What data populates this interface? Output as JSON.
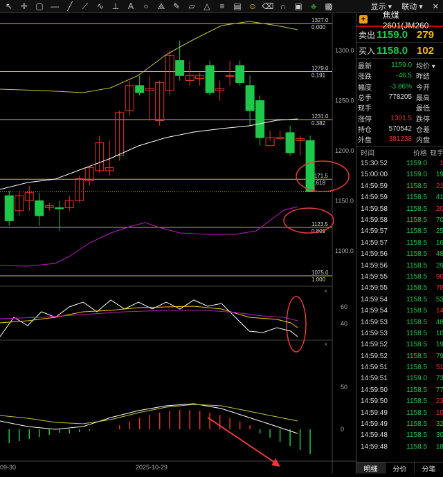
{
  "toolbar": {
    "icons": [
      "cursor-icon",
      "crosshair-icon",
      "rect-icon",
      "hline-icon",
      "channel-icon",
      "ray-icon",
      "wave-icon",
      "measure-icon",
      "text-icon",
      "circle-icon",
      "fan-icon",
      "pen-icon",
      "parallel-icon",
      "triangle-icon",
      "fib-icon",
      "ruler-icon",
      "emoji-icon",
      "erase-icon",
      "magnet-icon",
      "lock-icon",
      "tree-icon",
      "pic-icon"
    ],
    "right_menu": [
      "显示 ▾",
      "联动 ▾",
      "✕"
    ]
  },
  "chart_main": {
    "price_labels": [
      "1300.0",
      "1250.0",
      "1200.0",
      "1150.0",
      "1100.0"
    ],
    "fib_levels": [
      {
        "price": "1327.0",
        "ratio": "0.000"
      },
      {
        "price": "1279.0",
        "ratio": "0.191"
      },
      {
        "price": "1231.0",
        "ratio": "0.382"
      },
      {
        "price": "1171.5",
        "ratio": "0.618"
      },
      {
        "price": "1123.5",
        "ratio": "0.809"
      },
      {
        "price": "1075.0",
        "ratio": "1.000"
      }
    ],
    "close_marker_price": "1159.0"
  },
  "indicator1": {
    "labels": [
      "60",
      "40"
    ]
  },
  "indicator2": {
    "labels": [
      "50",
      "0"
    ]
  },
  "xaxis": {
    "labels": [
      "09-30",
      "2025-10-29"
    ]
  },
  "panel": {
    "title": "焦煤2601(JM260",
    "sell": {
      "label": "卖出",
      "price": "1159.0",
      "vol": "279"
    },
    "buy": {
      "label": "买入",
      "price": "1158.0",
      "vol": "102"
    },
    "stats": [
      {
        "k": "最新",
        "v": "1159.0",
        "cls": "green",
        "k2": "均价 ▾"
      },
      {
        "k": "涨跌",
        "v": "-46.5",
        "cls": "green",
        "k2": "昨结"
      },
      {
        "k": "幅度",
        "v": "-3.86%",
        "cls": "green",
        "k2": "今开"
      },
      {
        "k": "总手",
        "v": "778205",
        "cls": "white",
        "k2": "最高"
      },
      {
        "k": "现手",
        "v": "",
        "cls": "white",
        "k2": "最低"
      },
      {
        "k": "涨停",
        "v": "1301.5",
        "cls": "red",
        "k2": "跌停"
      },
      {
        "k": "持仓",
        "v": "570542",
        "cls": "white",
        "k2": "仓差"
      },
      {
        "k": "外盘",
        "v": "381238",
        "cls": "red",
        "k2": "内盘"
      }
    ],
    "tick_headers": [
      "时间",
      "价格",
      "现手"
    ],
    "ticks": [
      {
        "t": "15:30:52",
        "p": "1159.0",
        "v": "1",
        "c": "red"
      },
      {
        "t": "15:00:00",
        "p": "1159.0",
        "v": "19",
        "c": "green"
      },
      {
        "t": "14:59:59",
        "p": "1158.5",
        "v": "21",
        "c": "red"
      },
      {
        "t": "14:59:59",
        "p": "1158.5",
        "v": "41",
        "c": "green"
      },
      {
        "t": "14:59:58",
        "p": "1158.5",
        "v": "20",
        "c": "red"
      },
      {
        "t": "14:59:58",
        "p": "1158.5",
        "v": "70",
        "c": "green"
      },
      {
        "t": "14:59:57",
        "p": "1158.5",
        "v": "25",
        "c": "green"
      },
      {
        "t": "14:59:57",
        "p": "1158.5",
        "v": "16",
        "c": "green"
      },
      {
        "t": "14:59:56",
        "p": "1158.5",
        "v": "48",
        "c": "green"
      },
      {
        "t": "14:59:56",
        "p": "1158.5",
        "v": "29",
        "c": "green"
      },
      {
        "t": "14:59:55",
        "p": "1158.5",
        "v": "90",
        "c": "red"
      },
      {
        "t": "14:59:55",
        "p": "1158.5",
        "v": "78",
        "c": "red"
      },
      {
        "t": "14:59:54",
        "p": "1158.5",
        "v": "53",
        "c": "green"
      },
      {
        "t": "14:59:54",
        "p": "1158.5",
        "v": "14",
        "c": "red"
      },
      {
        "t": "14:59:53",
        "p": "1158.5",
        "v": "48",
        "c": "green"
      },
      {
        "t": "14:59:53",
        "p": "1158.5",
        "v": "10",
        "c": "green"
      },
      {
        "t": "14:59:52",
        "p": "1158.5",
        "v": "19",
        "c": "green"
      },
      {
        "t": "14:59:52",
        "p": "1158.5",
        "v": "79",
        "c": "green"
      },
      {
        "t": "14:59:51",
        "p": "1158.5",
        "v": "51",
        "c": "red"
      },
      {
        "t": "14:59:51",
        "p": "1159.0",
        "v": "73",
        "c": "green"
      },
      {
        "t": "14:59:50",
        "p": "1158.5",
        "v": "77",
        "c": "green"
      },
      {
        "t": "14:59:50",
        "p": "1158.5",
        "v": "23",
        "c": "red"
      },
      {
        "t": "14:59:49",
        "p": "1158.5",
        "v": "10",
        "c": "red"
      },
      {
        "t": "14:59:49",
        "p": "1158.5",
        "v": "32",
        "c": "green"
      },
      {
        "t": "14:59:48",
        "p": "1158.5",
        "v": "30",
        "c": "green"
      },
      {
        "t": "14:59:48",
        "p": "1158.5",
        "v": "18",
        "c": "green"
      }
    ],
    "tabs": [
      "明细",
      "分价",
      "分笔"
    ]
  },
  "chart_data": {
    "type": "candlestick",
    "series": [
      {
        "name": "candles",
        "ohlc": [
          [
            1155,
            1160,
            1125,
            1130
          ],
          [
            1140,
            1160,
            1135,
            1155
          ],
          [
            1150,
            1165,
            1140,
            1158
          ],
          [
            1150,
            1158,
            1125,
            1135
          ],
          [
            1143,
            1148,
            1140,
            1145
          ],
          [
            1143,
            1150,
            1120,
            1142
          ],
          [
            1143,
            1155,
            1140,
            1150
          ],
          [
            1150,
            1175,
            1148,
            1172
          ],
          [
            1170,
            1185,
            1165,
            1183
          ],
          [
            1180,
            1215,
            1178,
            1208
          ],
          [
            1180,
            1210,
            1175,
            1183
          ],
          [
            1195,
            1240,
            1190,
            1238
          ],
          [
            1240,
            1270,
            1235,
            1265
          ],
          [
            1265,
            1275,
            1255,
            1258
          ],
          [
            1260,
            1275,
            1230,
            1262
          ],
          [
            1230,
            1270,
            1225,
            1268
          ],
          [
            1260,
            1300,
            1255,
            1295
          ],
          [
            1290,
            1310,
            1270,
            1275
          ],
          [
            1270,
            1290,
            1265,
            1275
          ],
          [
            1272,
            1278,
            1265,
            1275
          ],
          [
            1285,
            1290,
            1255,
            1258
          ],
          [
            1260,
            1270,
            1250,
            1262
          ],
          [
            1275,
            1290,
            1265,
            1275
          ],
          [
            1285,
            1290,
            1265,
            1268
          ],
          [
            1265,
            1275,
            1225,
            1240
          ],
          [
            1250,
            1255,
            1205,
            1213
          ],
          [
            1205,
            1220,
            1210,
            1213
          ],
          [
            1213,
            1220,
            1210,
            1213
          ],
          [
            1218,
            1225,
            1195,
            1198
          ],
          [
            1210,
            1215,
            1195,
            1212
          ],
          [
            1210,
            1215,
            1165,
            1159
          ]
        ]
      }
    ],
    "ylim": [
      1075,
      1327
    ]
  }
}
